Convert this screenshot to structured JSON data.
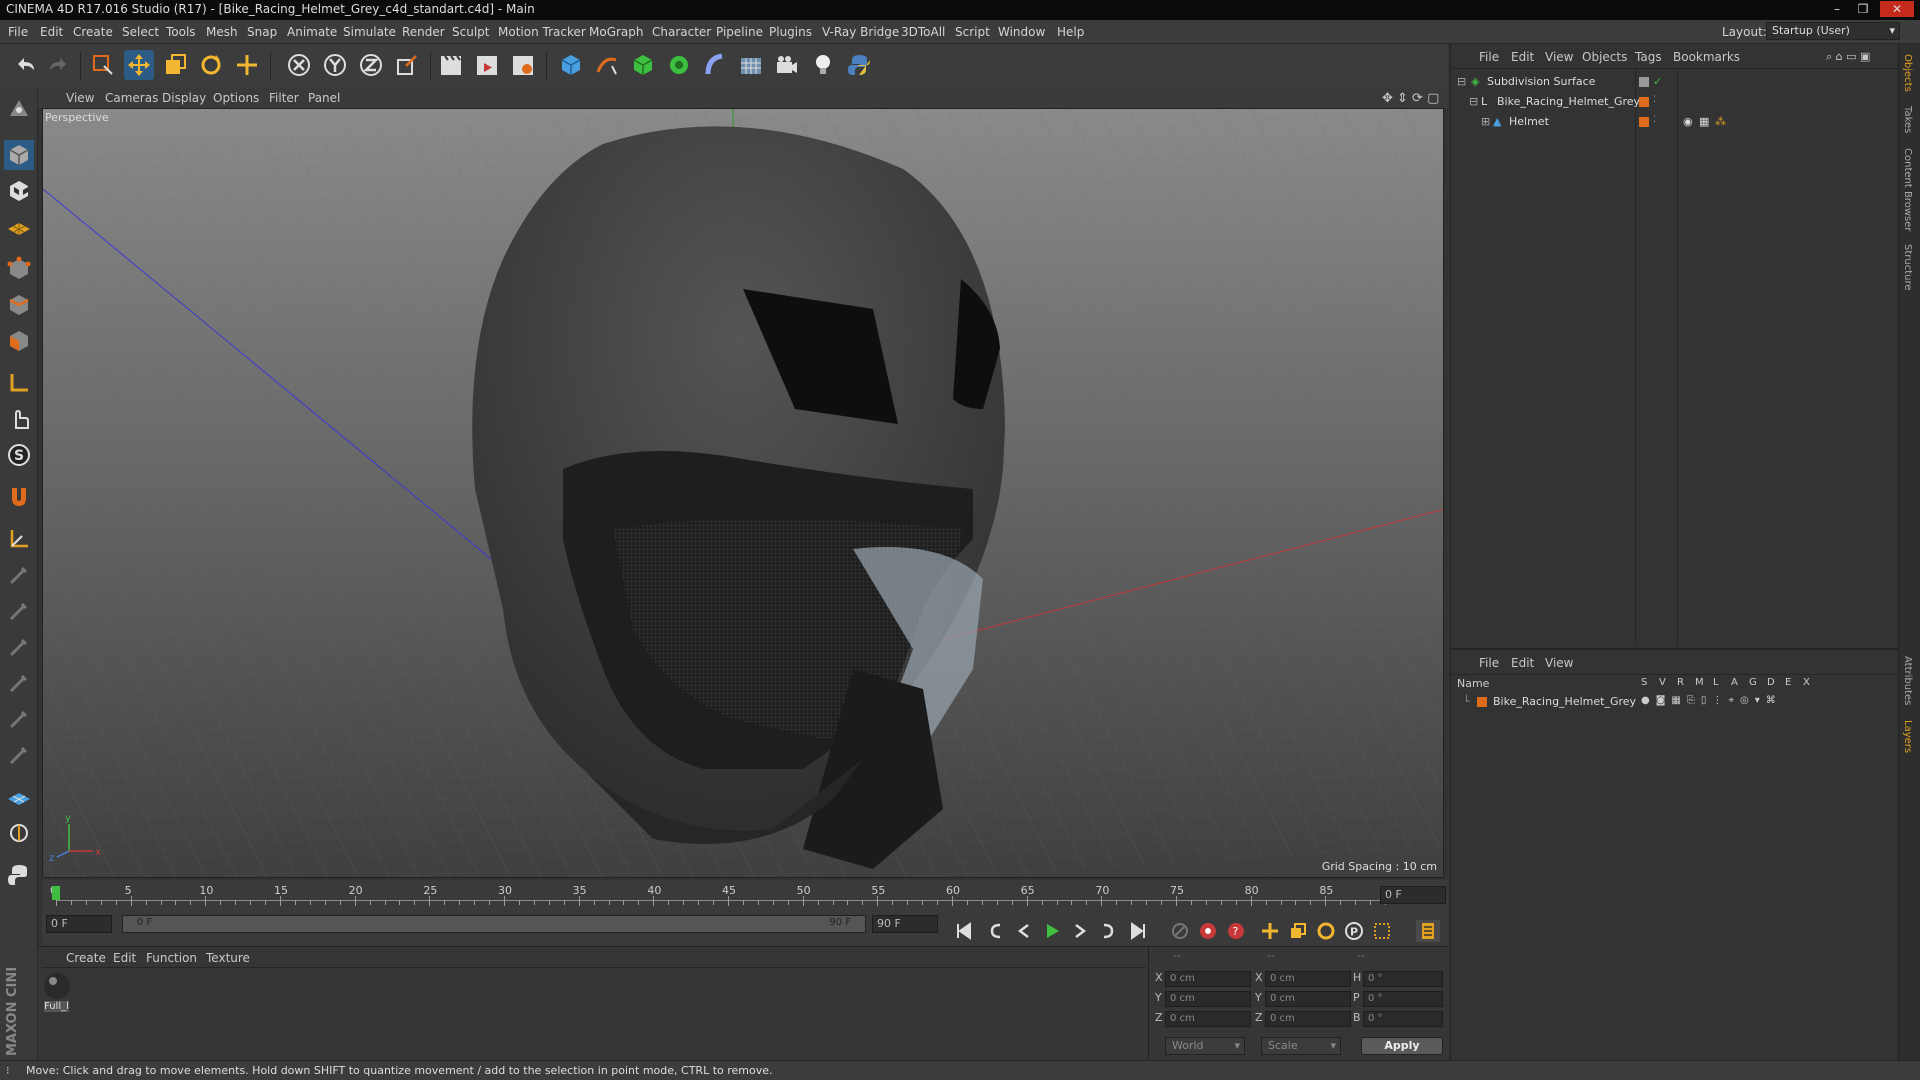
{
  "window": {
    "title": "CINEMA 4D R17.016 Studio (R17) - [Bike_Racing_Helmet_Grey_c4d_standart.c4d] - Main",
    "minimize": "–",
    "restore": "❐",
    "close": "✕"
  },
  "menubar": {
    "items": [
      "File",
      "Edit",
      "Create",
      "Select",
      "Tools",
      "Mesh",
      "Snap",
      "Animate",
      "Simulate",
      "Render",
      "Sculpt",
      "Motion Tracker",
      "MoGraph",
      "Character",
      "Pipeline",
      "Plugins",
      "V-Ray Bridge",
      "3DToAll",
      "Script",
      "Window",
      "Help"
    ],
    "layout_label": "Layout:",
    "layout_value": "Startup (User)"
  },
  "viewport": {
    "menu": [
      "View",
      "Cameras",
      "Display",
      "Options",
      "Filter",
      "Panel"
    ],
    "label": "Perspective",
    "grid_spacing": "Grid Spacing : 10 cm",
    "axis_y": "y",
    "axis_z": "z",
    "axis_x": "x"
  },
  "timeline": {
    "ticks": [
      "0",
      "5",
      "10",
      "15",
      "20",
      "25",
      "30",
      "35",
      "40",
      "45",
      "50",
      "55",
      "60",
      "65",
      "70",
      "75",
      "80",
      "85",
      "90"
    ],
    "current_frame": "0 F",
    "start_field": "0 F",
    "range_start": "0 F",
    "range_end": "90 F",
    "end_field": "90 F"
  },
  "material_panel": {
    "menu": [
      "Create",
      "Edit",
      "Function",
      "Texture"
    ],
    "materials": [
      {
        "name": "Full_l"
      }
    ]
  },
  "coords": {
    "headers": [
      "--",
      "--",
      "--"
    ],
    "rows": [
      {
        "l1": "X",
        "v1": "0 cm",
        "l2": "X",
        "v2": "0 cm",
        "l3": "H",
        "v3": "0 °"
      },
      {
        "l1": "Y",
        "v1": "0 cm",
        "l2": "Y",
        "v2": "0 cm",
        "l3": "P",
        "v3": "0 °"
      },
      {
        "l1": "Z",
        "v1": "0 cm",
        "l2": "Z",
        "v2": "0 cm",
        "l3": "B",
        "v3": "0 °"
      }
    ],
    "mode": "World",
    "scale": "Scale",
    "apply": "Apply"
  },
  "status": "Move: Click and drag to move elements. Hold down SHIFT to quantize movement / add to the selection in point mode, CTRL to remove.",
  "object_manager": {
    "menu": [
      "File",
      "Edit",
      "View",
      "Objects",
      "Tags",
      "Bookmarks"
    ],
    "objects": [
      {
        "name": "Subdivision Surface"
      },
      {
        "name": "Bike_Racing_Helmet_Grey"
      },
      {
        "name": "Helmet"
      }
    ]
  },
  "layer_manager": {
    "menu": [
      "File",
      "Edit",
      "View"
    ],
    "header_name": "Name",
    "columns": [
      "S",
      "V",
      "R",
      "M",
      "L",
      "A",
      "G",
      "D",
      "E",
      "X"
    ],
    "layers": [
      {
        "name": "Bike_Racing_Helmet_Grey"
      }
    ]
  },
  "right_tabs": [
    "Objects",
    "Takes",
    "Content Browser",
    "Structure",
    "Attributes",
    "Layers"
  ],
  "brand": "MAXON CINEMA 4D",
  "colors": {
    "accent": "#e06b1d",
    "selected_blue": "#4a9fe0",
    "axis_red": "#c83838",
    "axis_green": "#2a9a2a",
    "axis_blue": "#3a3ad0"
  }
}
